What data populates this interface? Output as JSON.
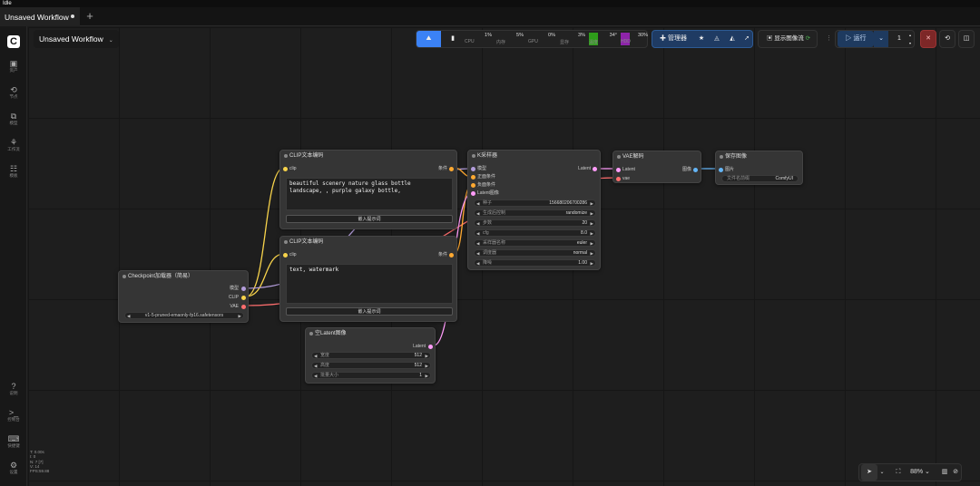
{
  "window": {
    "status": "Idle"
  },
  "tabs": {
    "active_label": "Unsaved Workflow",
    "add_label": "+"
  },
  "workflow": {
    "title": "Unsaved Workflow",
    "chevron": "⌄"
  },
  "sidebar": {
    "logo": "C",
    "top_items": [
      {
        "icon": "image-icon",
        "glyph": "▣",
        "label": "资产"
      },
      {
        "icon": "nodes-icon",
        "glyph": "⟲",
        "label": "节点"
      },
      {
        "icon": "model-icon",
        "glyph": "⧉",
        "label": "模型"
      },
      {
        "icon": "workflow-icon",
        "glyph": "⚘",
        "label": "工作流"
      },
      {
        "icon": "template-icon",
        "glyph": "☷",
        "label": "模板"
      }
    ],
    "bottom_items": [
      {
        "icon": "help-icon",
        "glyph": "?",
        "label": "说明"
      },
      {
        "icon": "terminal-icon",
        "glyph": ">_",
        "label": "控制台"
      },
      {
        "icon": "shortcut-icon",
        "glyph": "⌨",
        "label": "快捷键"
      },
      {
        "icon": "settings-icon",
        "glyph": "⚙",
        "label": "设置"
      }
    ]
  },
  "toolbar": {
    "monitors": [
      {
        "name": "CPU",
        "pct": "1%"
      },
      {
        "name": "内存",
        "pct": "5%"
      },
      {
        "name": "GPU",
        "pct": "0%"
      },
      {
        "name": "显存",
        "pct": "3%"
      },
      {
        "name": "温度",
        "pct": "34°"
      },
      {
        "name": "HDD",
        "pct": "30%"
      }
    ],
    "manager_label": "管理器",
    "show_image_label": "显示图像流",
    "run_label": "运行",
    "queue_count": "1"
  },
  "nodes": {
    "clip_top": {
      "title": "CLIP文本编码",
      "input": "clip",
      "output": "条件",
      "text": "beautiful scenery nature glass bottle\nlandscape, , purple galaxy bottle,",
      "button": "嵌入提示词"
    },
    "clip_bottom": {
      "title": "CLIP文本编码",
      "input": "clip",
      "output": "条件",
      "text": "text, watermark",
      "button": "嵌入提示词"
    },
    "checkpoint": {
      "title": "Checkpoint加载器（简易）",
      "outputs": [
        "模型",
        "CLIP",
        "VAE"
      ],
      "ckpt_name": "v1-5-pruned-emaonly-fp16.safetensors"
    },
    "latent": {
      "title": "空Latent图像",
      "output": "Latent",
      "widgets": [
        {
          "label": "宽度",
          "value": "512"
        },
        {
          "label": "高度",
          "value": "512"
        },
        {
          "label": "批量大小",
          "value": "1"
        }
      ]
    },
    "ksampler": {
      "title": "K采样器",
      "inputs": [
        "模型",
        "正面条件",
        "负面条件",
        "Latent图像"
      ],
      "output": "Latent",
      "widgets": [
        {
          "label": "种子",
          "value": "156680206700286"
        },
        {
          "label": "生成后控制",
          "value": "randomize"
        },
        {
          "label": "步数",
          "value": "20"
        },
        {
          "label": "cfg",
          "value": "8.0"
        },
        {
          "label": "采样器名称",
          "value": "euler"
        },
        {
          "label": "调度器",
          "value": "normal"
        },
        {
          "label": "降噪",
          "value": "1.00"
        }
      ]
    },
    "vae": {
      "title": "VAE解码",
      "inputs": [
        "Latent",
        "vae"
      ],
      "output": "图像"
    },
    "save": {
      "title": "保存图像",
      "input": "图片",
      "widget_label": "文件名前缀",
      "widget_value": "ComfyUI"
    }
  },
  "stats": {
    "lines": [
      "T: 0.00s",
      "I: 0",
      "N: 7 [7]",
      "V: 14",
      "FPS:59.88"
    ]
  },
  "bottom_tools": {
    "zoom": "88%"
  },
  "colors": {
    "accent": "#3b82f6",
    "clip": "#f7d34b",
    "model": "#b39ddb",
    "vae": "#ff6e6e",
    "latent": "#ff9cf9",
    "conditioning": "#ffa931",
    "image": "#64b5f6"
  }
}
